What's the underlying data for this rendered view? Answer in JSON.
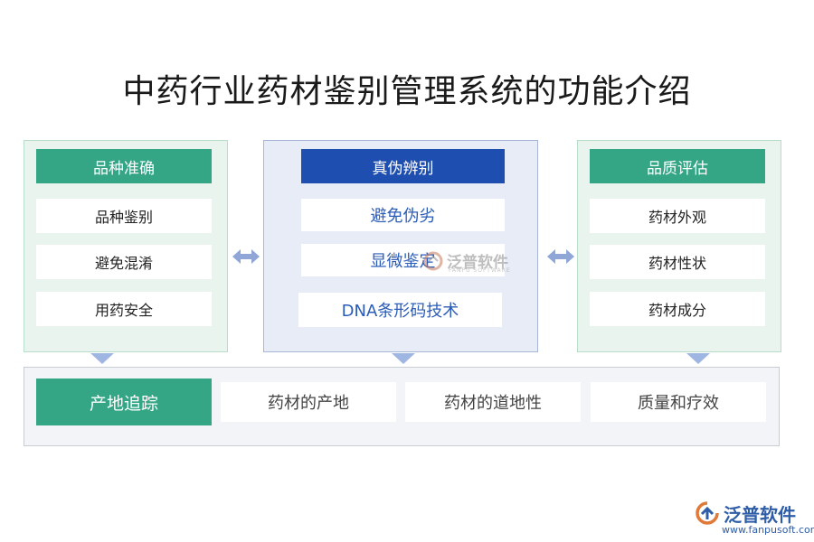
{
  "title": "中药行业药材鉴别管理系统的功能介绍",
  "left": {
    "header": "品种准确",
    "items": [
      "品种鉴别",
      "避免混淆",
      "用药安全"
    ]
  },
  "middle": {
    "header": "真伪辨别",
    "items": [
      "避免伪劣",
      "显微鉴定",
      "DNA条形码技术"
    ]
  },
  "right": {
    "header": "品质评估",
    "items": [
      "药材外观",
      "药材性状",
      "药材成分"
    ]
  },
  "bottom": {
    "header": "产地追踪",
    "items": [
      "药材的产地",
      "药材的道地性",
      "质量和疗效"
    ]
  },
  "watermark": {
    "text": "泛普软件",
    "sub": "FANPU SOFTWARE"
  },
  "logo": {
    "text": "泛普软件",
    "url": "www.fanpusoft.com"
  },
  "colors": {
    "green_header": "#34a585",
    "blue_header": "#1e4fb0",
    "arrow": "#8fa6d6"
  }
}
